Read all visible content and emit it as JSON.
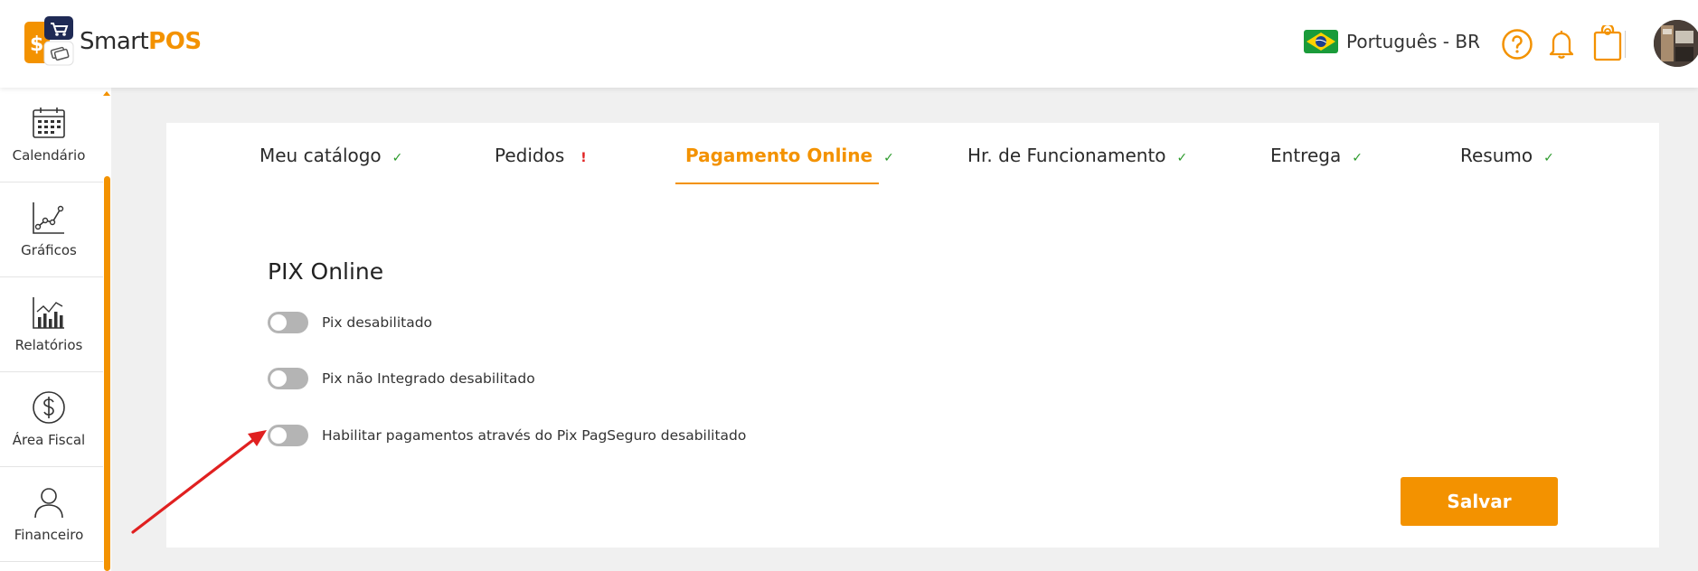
{
  "brand": {
    "part1": "Smart",
    "part2": "POS"
  },
  "header": {
    "language": "Português - BR"
  },
  "sidebar": {
    "items": [
      {
        "label": "Calendário",
        "icon": "calendar-icon"
      },
      {
        "label": "Gráficos",
        "icon": "line-chart-icon"
      },
      {
        "label": "Relatórios",
        "icon": "bar-chart-icon"
      },
      {
        "label": "Área Fiscal",
        "icon": "dollar-circle-icon"
      },
      {
        "label": "Financeiro",
        "icon": "person-icon"
      }
    ]
  },
  "tabs": [
    {
      "label": "Meu catálogo",
      "mark": "✓",
      "status": "ok"
    },
    {
      "label": "Pedidos",
      "mark": "!",
      "status": "warning"
    },
    {
      "label": "Pagamento Online",
      "mark": "✓",
      "status": "ok",
      "active": true
    },
    {
      "label": "Hr. de Funcionamento",
      "mark": "✓",
      "status": "ok"
    },
    {
      "label": "Entrega",
      "mark": "✓",
      "status": "ok"
    },
    {
      "label": "Resumo",
      "mark": "✓",
      "status": "ok"
    }
  ],
  "main": {
    "section_title": "PIX Online",
    "toggles": [
      {
        "label": "Pix desabilitado",
        "enabled": false
      },
      {
        "label": "Pix não Integrado desabilitado",
        "enabled": false
      },
      {
        "label": "Habilitar pagamentos através do Pix PagSeguro desabilitado",
        "enabled": false
      }
    ],
    "save_label": "Salvar"
  },
  "colors": {
    "accent": "#f39200",
    "ok": "#2a9a2a",
    "warning": "#e02020",
    "annotation_arrow": "#e02020"
  }
}
